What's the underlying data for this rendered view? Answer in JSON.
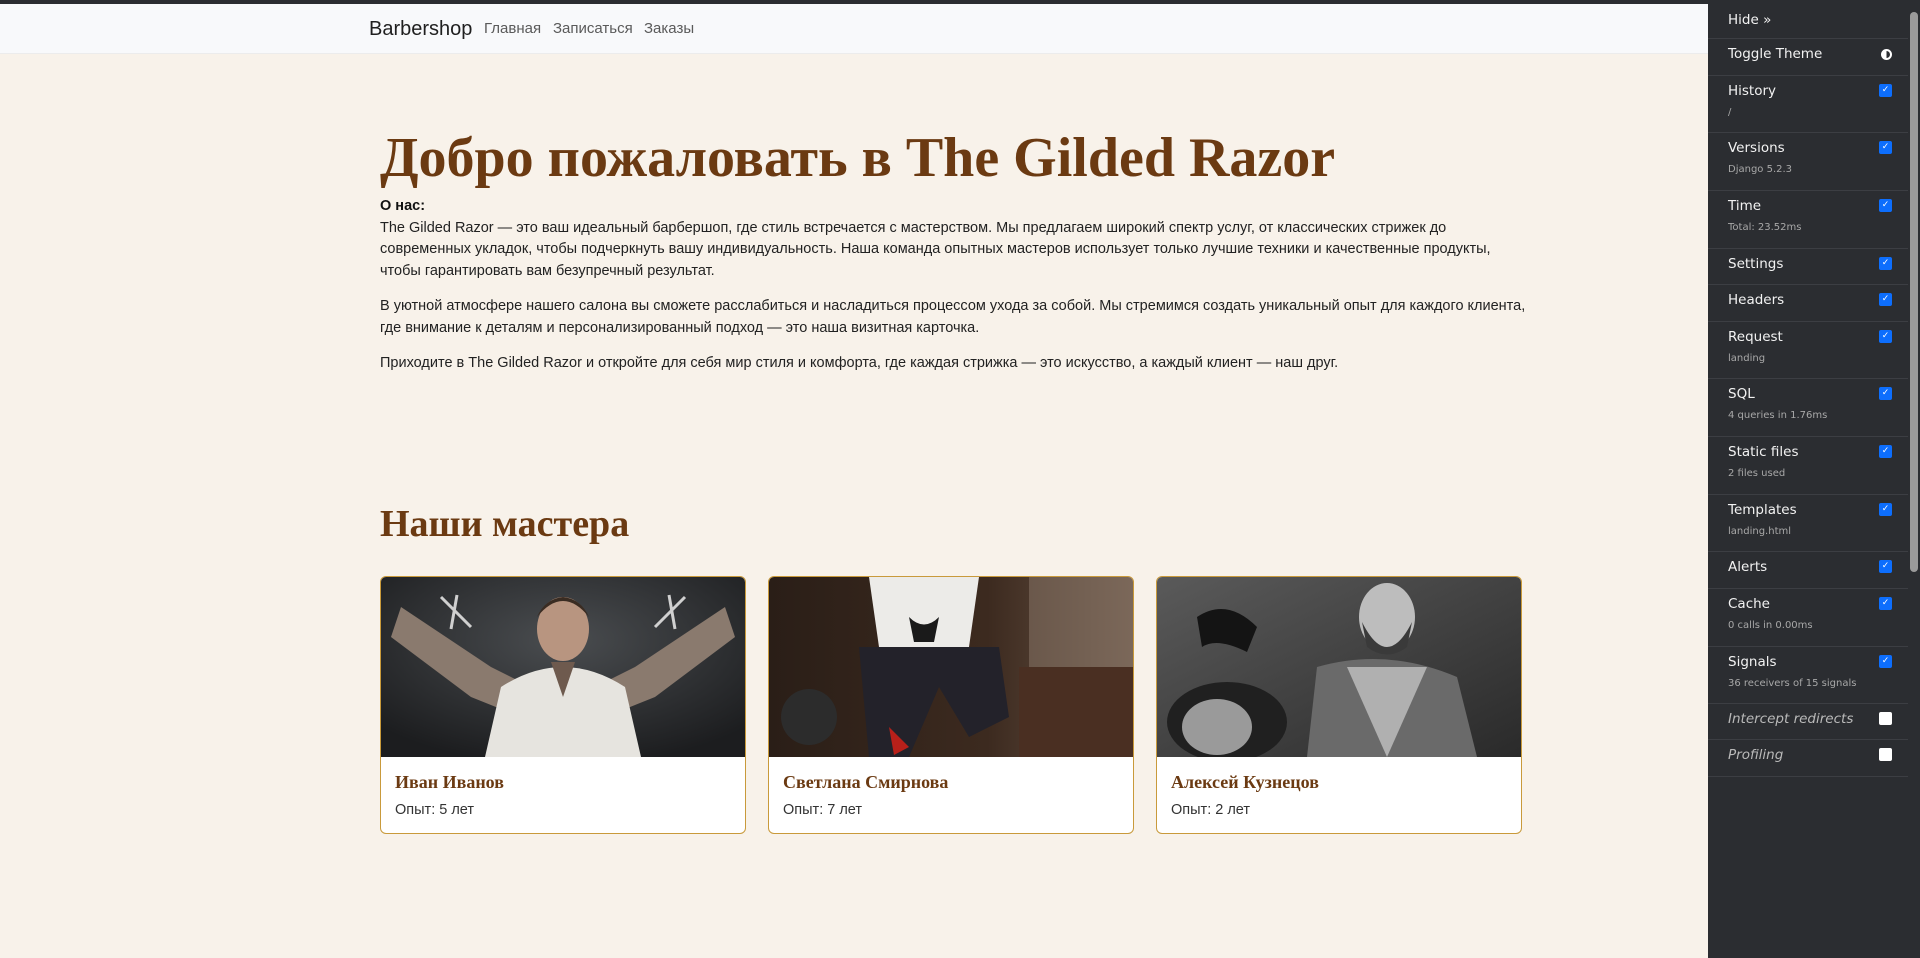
{
  "navbar": {
    "brand": "Barbershop",
    "links": [
      "Главная",
      "Записаться",
      "Заказы"
    ]
  },
  "hero": {
    "title": "Добро пожаловать в The Gilded Razor",
    "about_label": "О нас:",
    "paragraphs": [
      "The Gilded Razor — это ваш идеальный барбершоп, где стиль встречается с мастерством. Мы предлагаем широкий спектр услуг, от классических стрижек до современных укладок, чтобы подчеркнуть вашу индивидуальность. Наша команда опытных мастеров использует только лучшие техники и качественные продукты, чтобы гарантировать вам безупречный результат.",
      "В уютной атмосфере нашего салона вы сможете расслабиться и насладиться процессом ухода за собой. Мы стремимся создать уникальный опыт для каждого клиента, где внимание к деталям и персонализированный подход — это наша визитная карточка.",
      "Приходите в The Gilded Razor и откройте для себя мир стиля и комфорта, где каждая стрижка — это искусство, а каждый клиент — наш друг."
    ]
  },
  "masters": {
    "title": "Наши мастера",
    "cards": [
      {
        "name": "Иван Иванов",
        "experience": "Опыт: 5 лет"
      },
      {
        "name": "Светлана Смирнова",
        "experience": "Опыт: 7 лет"
      },
      {
        "name": "Алексей Кузнецов",
        "experience": "Опыт: 2 лет"
      }
    ]
  },
  "debug_toolbar": {
    "hide": "Hide »",
    "toggle_theme": "Toggle Theme",
    "panels": [
      {
        "label": "History",
        "sub": "/",
        "checked": true
      },
      {
        "label": "Versions",
        "sub": "Django 5.2.3",
        "checked": true
      },
      {
        "label": "Time",
        "sub": "Total: 23.52ms",
        "checked": true
      },
      {
        "label": "Settings",
        "sub": "",
        "checked": true
      },
      {
        "label": "Headers",
        "sub": "",
        "checked": true
      },
      {
        "label": "Request",
        "sub": "landing",
        "checked": true
      },
      {
        "label": "SQL",
        "sub": "4 queries in 1.76ms",
        "checked": true
      },
      {
        "label": "Static files",
        "sub": "2 files used",
        "checked": true
      },
      {
        "label": "Templates",
        "sub": "landing.html",
        "checked": true
      },
      {
        "label": "Alerts",
        "sub": "",
        "checked": true
      },
      {
        "label": "Cache",
        "sub": "0 calls in 0.00ms",
        "checked": true
      },
      {
        "label": "Signals",
        "sub": "36 receivers of 15 signals",
        "checked": true
      },
      {
        "label": "Intercept redirects",
        "sub": "",
        "checked": false
      },
      {
        "label": "Profiling",
        "sub": "",
        "checked": false
      }
    ]
  },
  "colors": {
    "accent": "#6b3a12",
    "card_border": "#c99a3b",
    "page_bg": "#f8f2ea",
    "toolbar_bg": "#2b2d31"
  }
}
